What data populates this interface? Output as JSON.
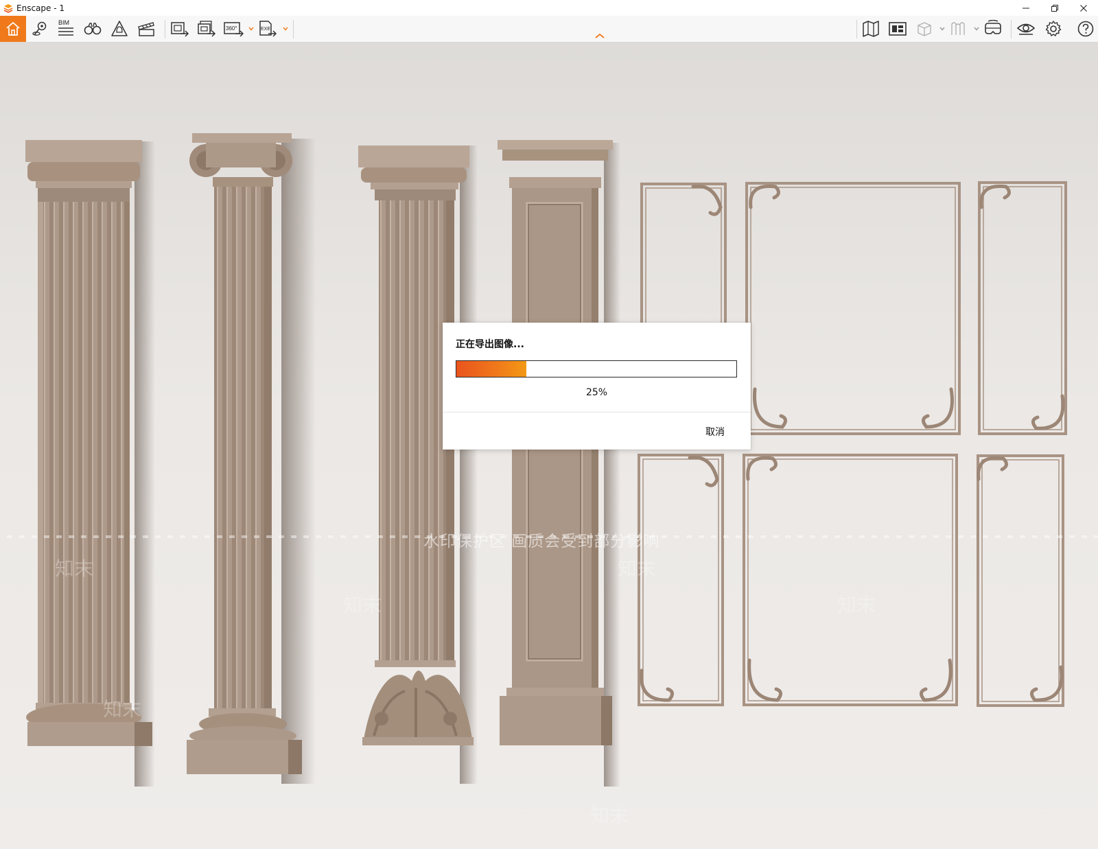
{
  "window": {
    "title": "Enscape - 1",
    "brand_color": "#f07a1b",
    "controls": {
      "minimize": "–",
      "restore": "❐",
      "close": "✕"
    }
  },
  "toolbar": {
    "bim_label": "BIM",
    "panorama_label": "360°",
    "exe_label": "EXE",
    "left_icons": [
      "home-icon",
      "location-pin-icon",
      "bim-list-icon",
      "binoculars-icon",
      "sun-house-icon",
      "clapperboard-icon",
      "screenshot-export-icon",
      "batch-export-icon",
      "panorama-export-icon",
      "exe-export-icon"
    ],
    "right_icons": [
      "map-icon",
      "asset-library-icon",
      "cube-icon",
      "material-icon",
      "vr-headset-icon",
      "eye-icon",
      "gear-icon",
      "help-icon"
    ]
  },
  "watermark": {
    "text": "水印保护区  画质会受到部分影响",
    "logo_text": "知末"
  },
  "dialog": {
    "title": "正在导出图像...",
    "progress": 25,
    "progress_label": "25%",
    "cancel_label": "取消"
  }
}
